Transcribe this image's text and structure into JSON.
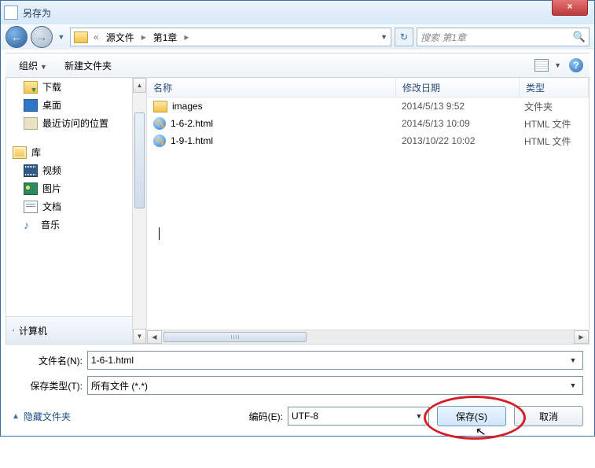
{
  "title": "另存为",
  "breadcrumb": {
    "level1": "源文件",
    "level2": "第1章"
  },
  "search_placeholder": "搜索 第1章",
  "toolbar": {
    "organize": "组织",
    "newfolder": "新建文件夹"
  },
  "sidebar": {
    "downloads": "下载",
    "desktop": "桌面",
    "recent": "最近访问的位置",
    "libraries": "库",
    "videos": "视频",
    "pictures": "图片",
    "documents": "文档",
    "music": "音乐",
    "computer": "计算机"
  },
  "columns": {
    "name": "名称",
    "date": "修改日期",
    "type": "类型"
  },
  "files": [
    {
      "name": "images",
      "date": "2014/5/13 9:52",
      "type": "文件夹",
      "icon": "folder"
    },
    {
      "name": "1-6-2.html",
      "date": "2014/5/13 10:09",
      "type": "HTML 文件",
      "icon": "ie"
    },
    {
      "name": "1-9-1.html",
      "date": "2013/10/22 10:02",
      "type": "HTML 文件",
      "icon": "ie"
    }
  ],
  "filename_label": "文件名(N):",
  "filename_value": "1-6-1.html",
  "filetype_label": "保存类型(T):",
  "filetype_value": "所有文件 (*.*)",
  "encoding_label": "编码(E):",
  "encoding_value": "UTF-8",
  "hide_folders": "隐藏文件夹",
  "save_btn": "保存(S)",
  "cancel_btn": "取消"
}
